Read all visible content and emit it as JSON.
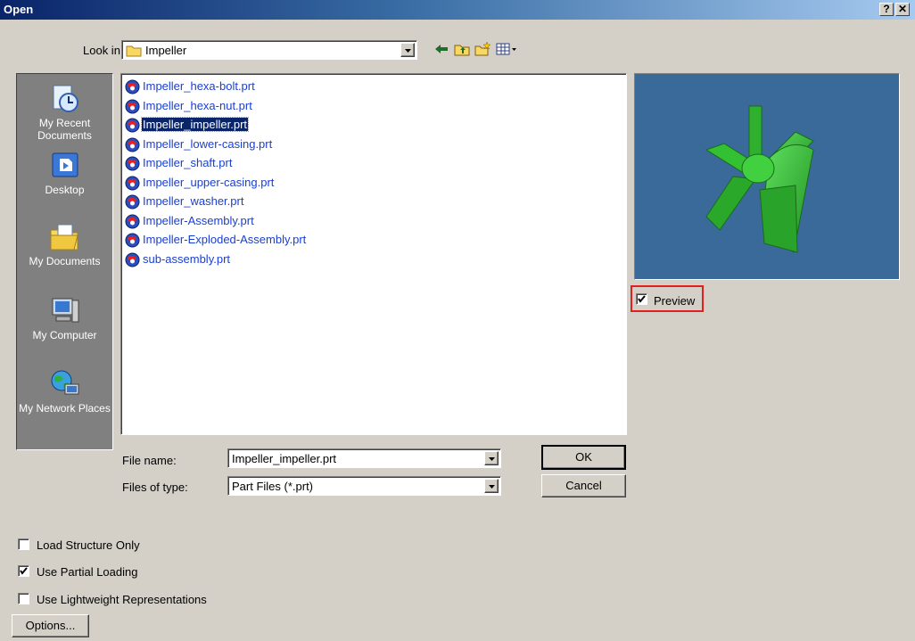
{
  "window": {
    "title": "Open",
    "help": "?",
    "close": "✕"
  },
  "lookin": {
    "label": "Look in:",
    "value": "Impeller"
  },
  "places": [
    {
      "label": "My Recent Documents"
    },
    {
      "label": "Desktop"
    },
    {
      "label": "My Documents"
    },
    {
      "label": "My Computer"
    },
    {
      "label": "My Network Places"
    }
  ],
  "files": [
    "Impeller_hexa-bolt.prt",
    "Impeller_hexa-nut.prt",
    "Impeller_impeller.prt",
    "Impeller_lower-casing.prt",
    "Impeller_shaft.prt",
    "Impeller_upper-casing.prt",
    "Impeller_washer.prt",
    "Impeller-Assembly.prt",
    "Impeller-Exploded-Assembly.prt",
    "sub-assembly.prt"
  ],
  "selected_file": "Impeller_impeller.prt",
  "preview": {
    "label": "Preview",
    "checked": true,
    "highlight_color": "#e02020"
  },
  "filename": {
    "label": "File name:",
    "value": "Impeller_impeller.prt"
  },
  "filetype": {
    "label": "Files of type:",
    "value": "Part Files (*.prt)"
  },
  "buttons": {
    "ok": "OK",
    "cancel": "Cancel",
    "options": "Options..."
  },
  "options": [
    {
      "label": "Load Structure Only",
      "checked": false
    },
    {
      "label": "Use Partial Loading",
      "checked": true
    },
    {
      "label": "Use Lightweight Representations",
      "checked": false
    }
  ],
  "colors": {
    "title_start": "#0a246a",
    "title_end": "#a6caf0",
    "selection": "#0a246a",
    "preview_bg": "#3a6a9a",
    "part_green": "#33cc33"
  }
}
